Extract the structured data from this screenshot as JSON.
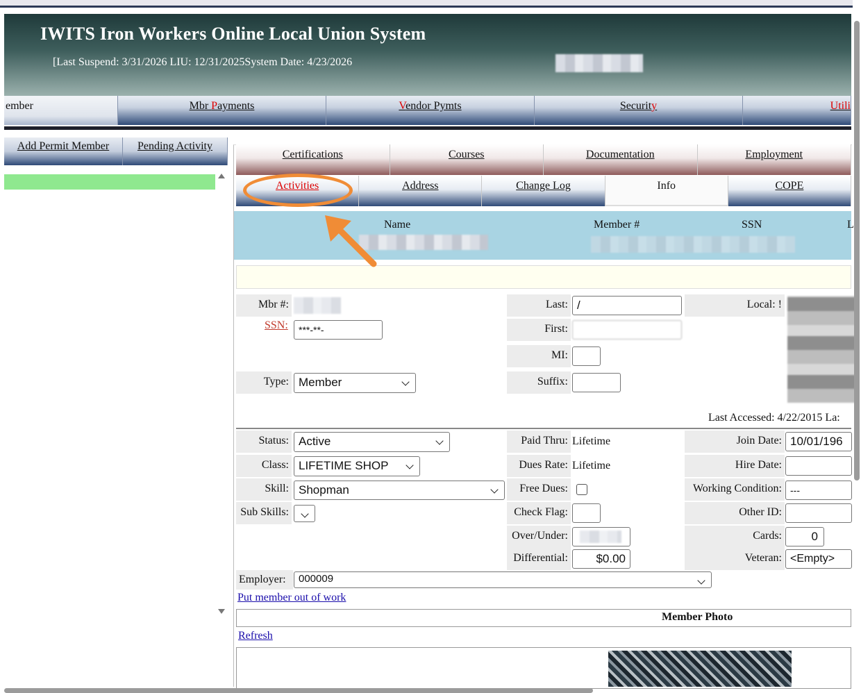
{
  "header": {
    "title": "IWITS Iron Workers Online Local Union System",
    "subtitle": "[Last Suspend: 3/31/2026 LIU: 12/31/2025System Date: 4/23/2026"
  },
  "main_nav": {
    "member_tab": "ember",
    "mbr_payments_pre": "Mbr ",
    "mbr_payments_hot": "P",
    "mbr_payments_post": "ayments",
    "vendor_hot": "V",
    "vendor_post": "endor Pymts",
    "security_pre": "Securit",
    "security_hot": "y",
    "utilities_hot": "Utili"
  },
  "left_nav": {
    "add_permit_member": "Add Permit Member",
    "pending_activity": "Pending Activity"
  },
  "sub_tabs_row1": [
    "Certifications",
    "Courses",
    "Documentation",
    "Employment"
  ],
  "sub_tabs_row2": [
    "Activities",
    "Address",
    "Change Log",
    "Info",
    "COPE"
  ],
  "member_header": {
    "name": "Name",
    "member_no": "Member #",
    "ssn": "SSN",
    "last_col": "L"
  },
  "form": {
    "mbr_no_label": "Mbr #:",
    "ssn_label": "SSN:",
    "ssn_value": "***-**-",
    "type_label": "Type:",
    "type_value": "Member",
    "last_label": "Last:",
    "last_value": "/",
    "first_label": "First:",
    "mi_label": "MI:",
    "suffix_label": "Suffix:",
    "local_label": "Local:",
    "local_value": "!",
    "last_accessed": "Last Accessed: 4/22/2015 La:",
    "status_label": "Status:",
    "status_value": "Active",
    "class_label": "Class:",
    "class_value": "LIFETIME SHOP",
    "skill_label": "Skill:",
    "skill_value": "Shopman",
    "sub_skills_label": "Sub Skills:",
    "paid_thru_label": "Paid Thru:",
    "paid_thru_value": "Lifetime",
    "dues_rate_label": "Dues Rate:",
    "dues_rate_value": "Lifetime",
    "free_dues_label": "Free Dues:",
    "check_flag_label": "Check Flag:",
    "over_under_label": "Over/Under:",
    "differential_label": "Differential:",
    "differential_value": "$0.00",
    "join_date_label": "Join Date:",
    "join_date_value": "10/01/196",
    "hire_date_label": "Hire Date:",
    "working_condition_label": "Working Condition:",
    "working_condition_value": "---",
    "other_id_label": "Other ID:",
    "cards_label": "Cards:",
    "cards_value": "0",
    "veteran_label": "Veteran:",
    "veteran_value": "<Empty>",
    "employer_label": "Employer:",
    "employer_value": "000009",
    "put_out_of_work": "Put member out of work",
    "member_photo": "Member Photo",
    "refresh": "Refresh"
  },
  "annotation": {
    "color": "#f08c36"
  }
}
